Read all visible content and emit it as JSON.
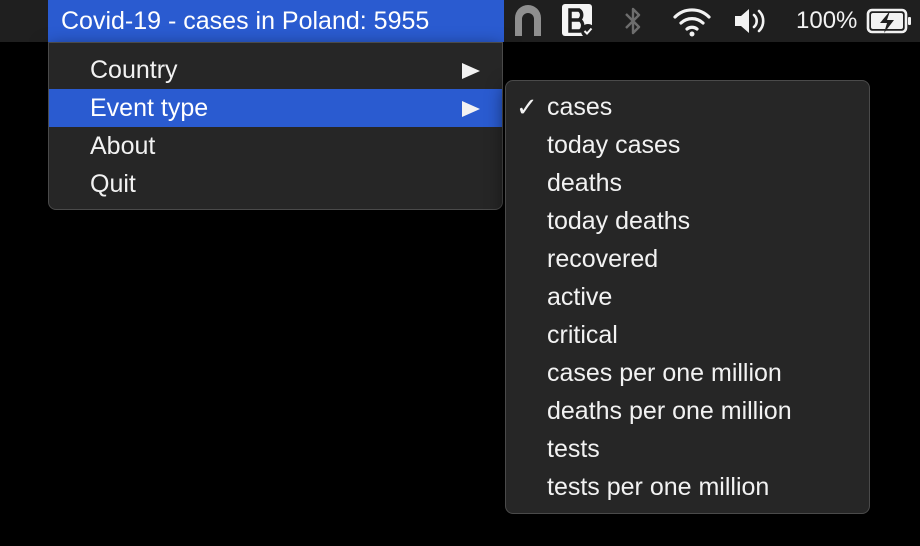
{
  "menubar": {
    "status_title": "Covid-19 - cases in Poland: 5955",
    "battery_percent": "100%",
    "tray_icons": [
      "arch-icon",
      "bartender-icon",
      "bluetooth-icon",
      "wifi-icon",
      "volume-icon",
      "battery-charging-icon"
    ]
  },
  "main_menu": {
    "items": [
      {
        "label": "Country",
        "has_submenu": true
      },
      {
        "label": "Event type",
        "has_submenu": true,
        "highlighted": true
      },
      {
        "label": "About"
      },
      {
        "label": "Quit"
      }
    ]
  },
  "submenu": {
    "selected": "cases",
    "check_glyph": "✓",
    "items": [
      {
        "label": "cases"
      },
      {
        "label": "today cases"
      },
      {
        "label": "deaths"
      },
      {
        "label": "today deaths"
      },
      {
        "label": "recovered"
      },
      {
        "label": "active"
      },
      {
        "label": "critical"
      },
      {
        "label": "cases per one million"
      },
      {
        "label": "deaths per one million"
      },
      {
        "label": "tests"
      },
      {
        "label": "tests per one million"
      }
    ]
  },
  "colors": {
    "highlight": "#2a5bd0",
    "menu_bg": "#262626",
    "menubar_bg": "#1f1f1f"
  },
  "submenu_arrow_glyph": "▶"
}
